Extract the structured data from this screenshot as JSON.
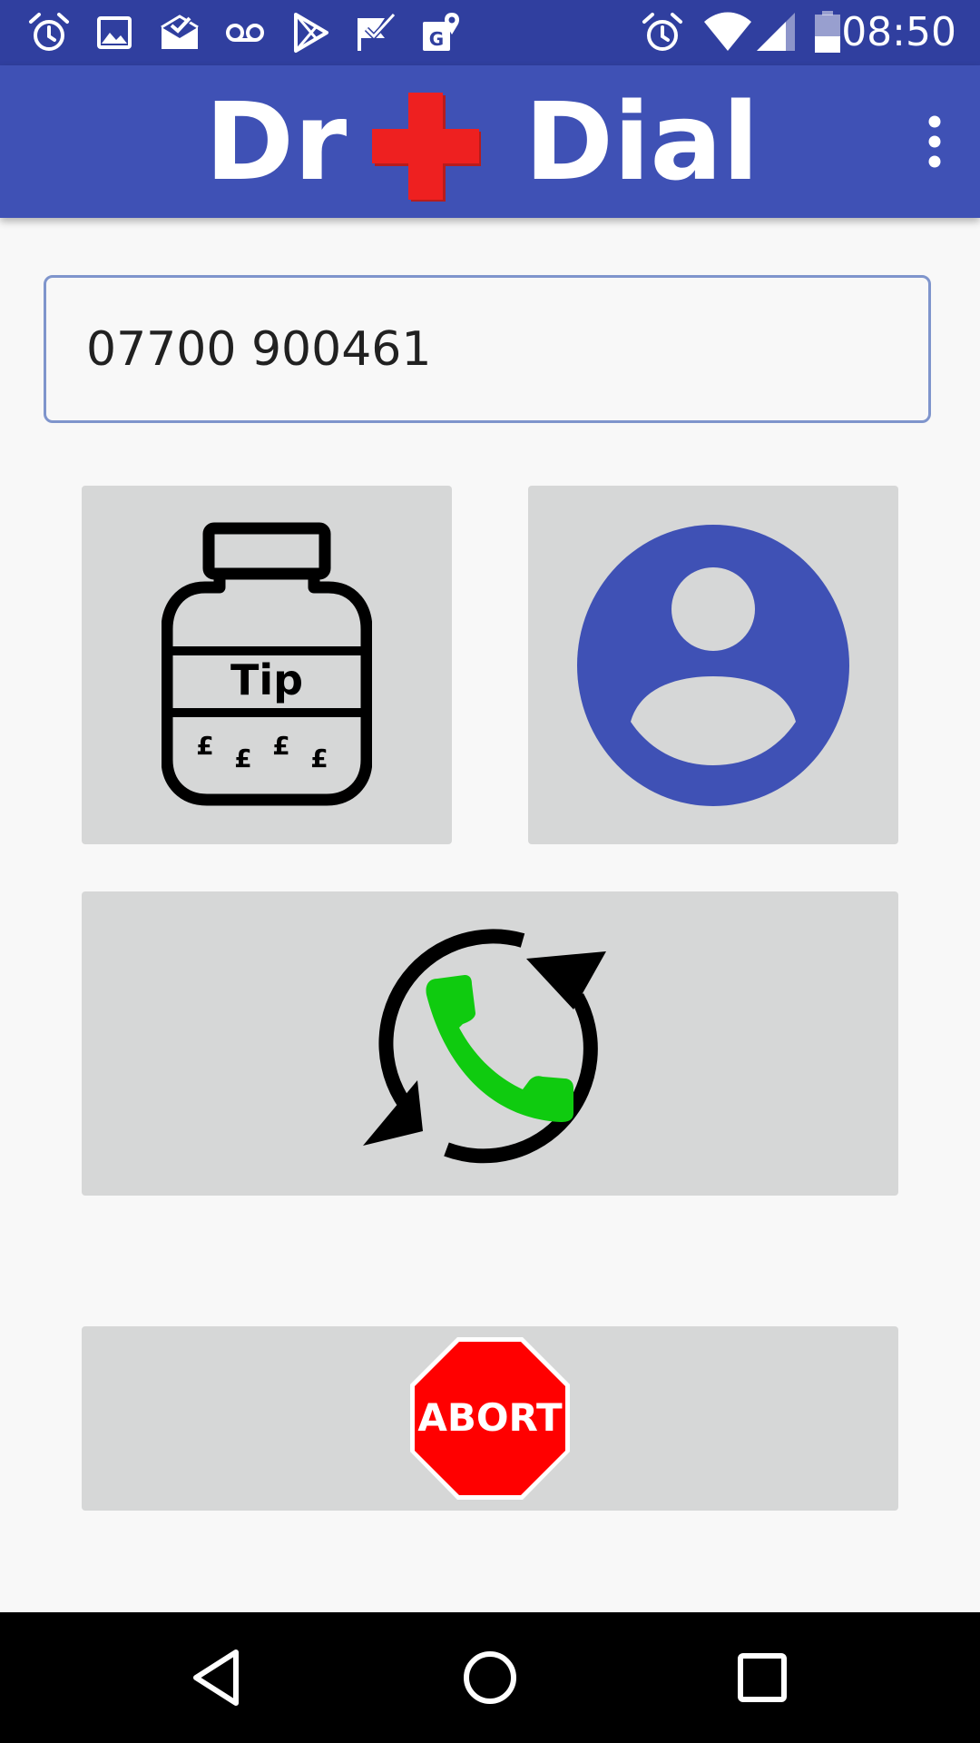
{
  "status_bar": {
    "time": "08:50",
    "left_icons": [
      "alarm-icon",
      "image-icon",
      "mail-done-icon",
      "voicemail-icon",
      "play-store-icon",
      "task-check-icon",
      "maps-icon"
    ],
    "right_icons": [
      "alarm-icon",
      "wifi-icon",
      "cell-signal-icon",
      "battery-icon"
    ]
  },
  "app_bar": {
    "title_left": "Dr",
    "title_right": "Dial",
    "logo_icon": "red-cross-icon",
    "menu_icon": "overflow-menu-icon",
    "background": "#3f51b5"
  },
  "phone_input": {
    "value": "07700 900461",
    "placeholder": ""
  },
  "tiles": {
    "tip": {
      "icon": "tip-jar-icon",
      "jar_label": "Tip",
      "coin_symbol": "£"
    },
    "contact": {
      "icon": "contact-avatar-icon",
      "color": "#3f51b5"
    },
    "redial": {
      "icon": "redial-phone-icon",
      "phone_color": "#0fcb0f"
    },
    "abort": {
      "icon": "stop-sign-icon",
      "label": "ABORT",
      "color": "#ff0000"
    }
  },
  "nav_bar": {
    "back_icon": "back-icon",
    "home_icon": "home-icon",
    "recents_icon": "recents-icon"
  }
}
